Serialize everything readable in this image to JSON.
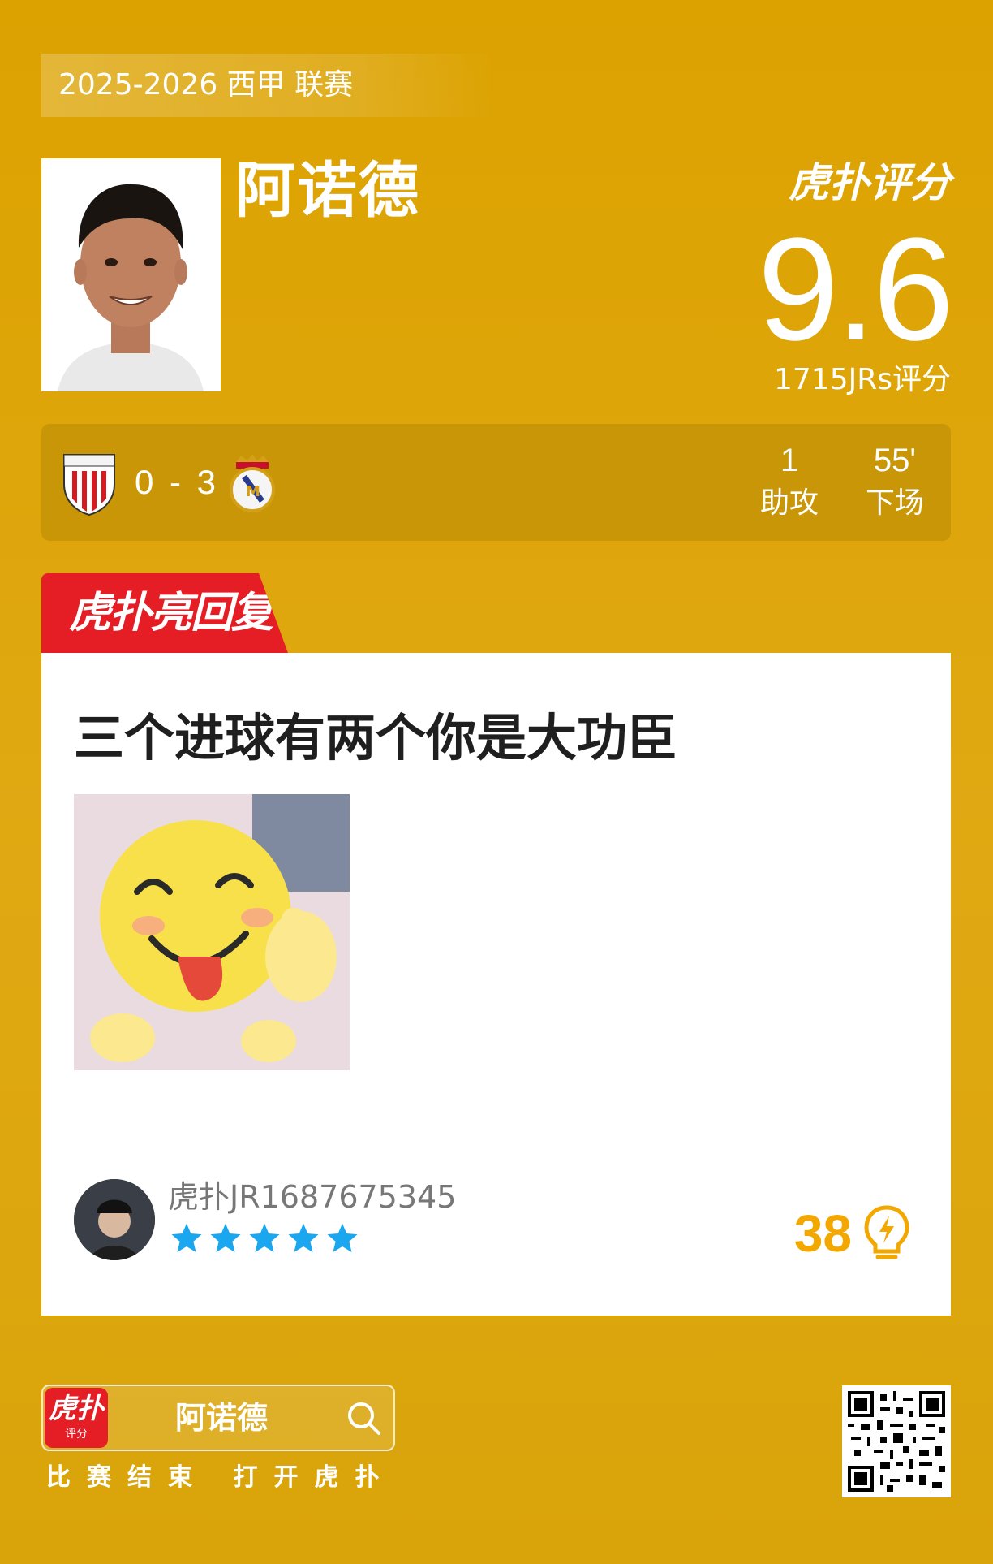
{
  "header": {
    "season": "2025-2026 西甲 联赛",
    "player_name": "阿诺德",
    "rating_brand": "虎扑评分",
    "score": "9.6",
    "votes": "1715JRs评分"
  },
  "match": {
    "score": "0 - 3",
    "home_badge": "athletic-club-badge",
    "away_badge": "real-madrid-badge",
    "stats": [
      {
        "value": "1",
        "label": "助攻"
      },
      {
        "value": "55'",
        "label": "下场"
      }
    ]
  },
  "comment": {
    "section_label": "虎扑亮回复",
    "text": "三个进球有两个你是大功臣",
    "meme": "laughing-emoji-sticker",
    "username": "虎扑JR1687675345",
    "stars": 5,
    "likes": "38",
    "colors": {
      "stars": "#1aa7f0",
      "likes": "#f2a800",
      "section": "#e51e26"
    }
  },
  "footer": {
    "app_icon_big": "虎扑",
    "app_icon_small": "评分",
    "search_text": "阿诺德",
    "cta": "比赛结束 打开虎扑"
  },
  "colors": {
    "background": "#dca200"
  }
}
